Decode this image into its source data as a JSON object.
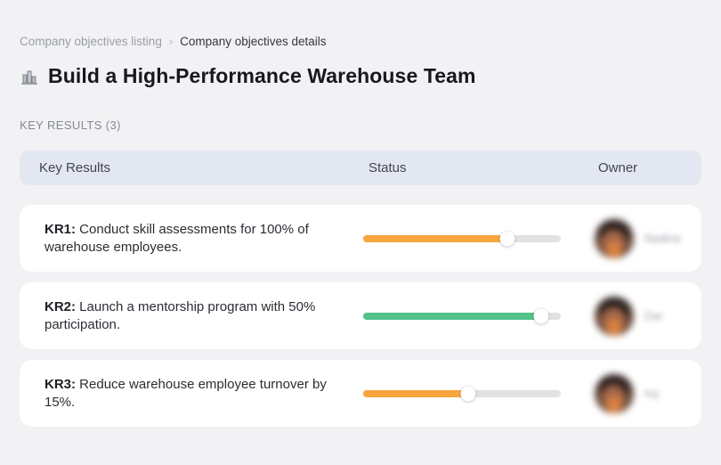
{
  "breadcrumb": {
    "items": [
      {
        "label": "Company objectives listing"
      },
      {
        "label": "Company objectives details"
      }
    ],
    "separator": "›"
  },
  "header": {
    "icon": "buildings-icon",
    "title": "Build a High-Performance Warehouse Team"
  },
  "section": {
    "label": "KEY RESULTS (3)"
  },
  "table": {
    "headers": {
      "key_results": "Key Results",
      "status": "Status",
      "owner": "Owner"
    }
  },
  "rows": [
    {
      "kr_label": "KR1:",
      "description": "Conduct skill assessments for 100% of warehouse employees.",
      "progress": {
        "percent": 73,
        "width": "73%",
        "color": "#f8a53e",
        "color_name": "orange"
      },
      "owner": {
        "name": "Nadine"
      }
    },
    {
      "kr_label": "KR2:",
      "description": "Launch a mentorship program with 50% participation.",
      "progress": {
        "percent": 90,
        "width": "90%",
        "color": "#52c289",
        "color_name": "green"
      },
      "owner": {
        "name": "Dai"
      }
    },
    {
      "kr_label": "KR3:",
      "description": "Reduce warehouse employee turnover by 15%.",
      "progress": {
        "percent": 53,
        "width": "53%",
        "color": "#f8a53e",
        "color_name": "orange"
      },
      "owner": {
        "name": "Ivy"
      }
    }
  ],
  "colors": {
    "page_background": "#f2f2f4",
    "card_background": "#ffffff",
    "table_header_background": "#e3e7f1",
    "track": "#e2e2e2",
    "orange": "#f8a53e",
    "green": "#52c289"
  }
}
